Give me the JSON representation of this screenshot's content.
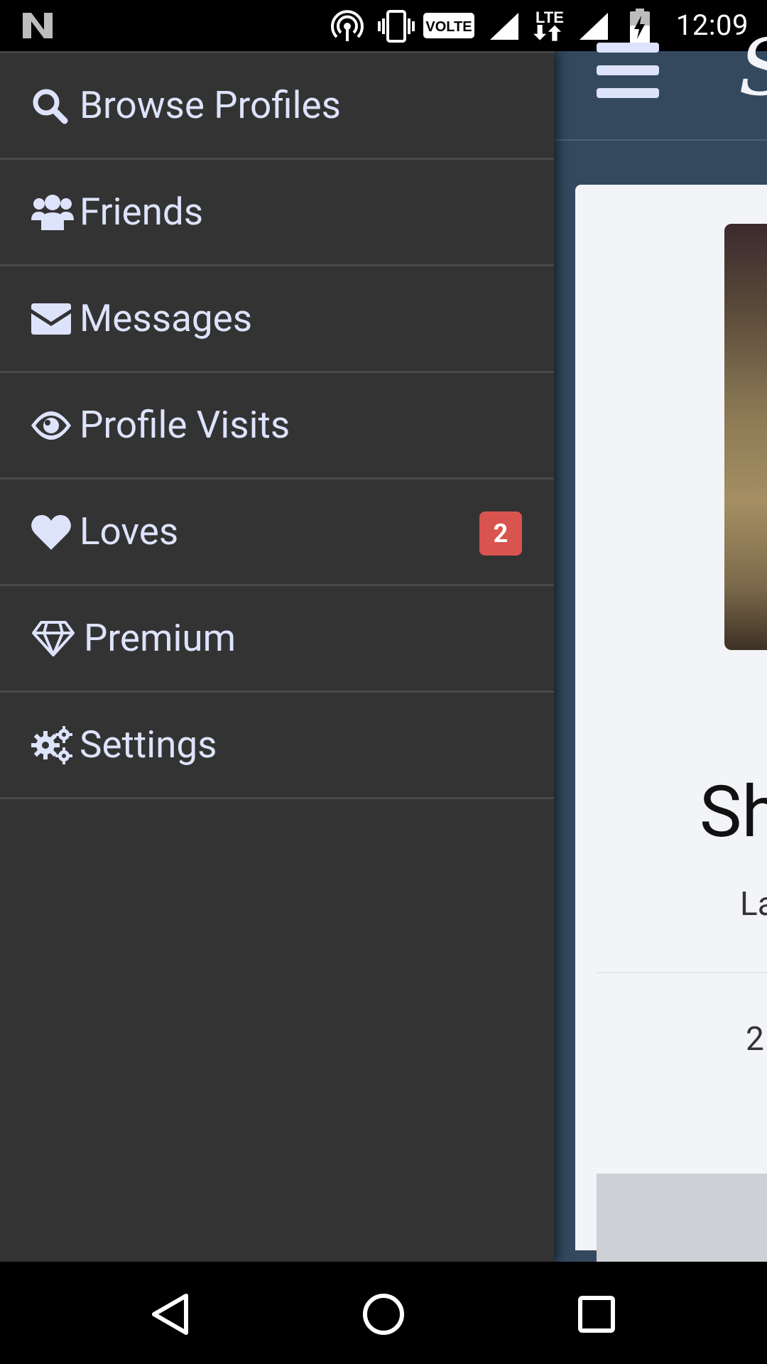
{
  "status_bar": {
    "time": "12:09",
    "volte_label": "VOLTE",
    "lte_label": "LTE",
    "icons": [
      "n-logo-icon",
      "hotspot-icon",
      "vibrate-icon",
      "volte-icon",
      "signal-icon",
      "lte-icon",
      "signal-icon",
      "battery-charging-icon"
    ]
  },
  "drawer": {
    "items": [
      {
        "label": "Browse Profiles",
        "icon": "search-icon"
      },
      {
        "label": "Friends",
        "icon": "users-icon"
      },
      {
        "label": "Messages",
        "icon": "envelope-icon"
      },
      {
        "label": "Profile Visits",
        "icon": "eye-icon"
      },
      {
        "label": "Loves",
        "icon": "heart-icon",
        "badge": "2"
      },
      {
        "label": "Premium",
        "icon": "diamond-icon"
      },
      {
        "label": "Settings",
        "icon": "gears-icon"
      }
    ]
  },
  "page": {
    "brand_glyph": "S",
    "name_fragment": "Sh",
    "subtitle_fragment": "La",
    "number_fragment": "2"
  },
  "colors": {
    "drawer_bg": "#333333",
    "drawer_text": "#dde3fb",
    "page_bg": "#34495e",
    "badge_bg": "#d9534f"
  },
  "navigation_bar": {
    "buttons": [
      "back-icon",
      "home-icon",
      "recents-icon"
    ]
  }
}
